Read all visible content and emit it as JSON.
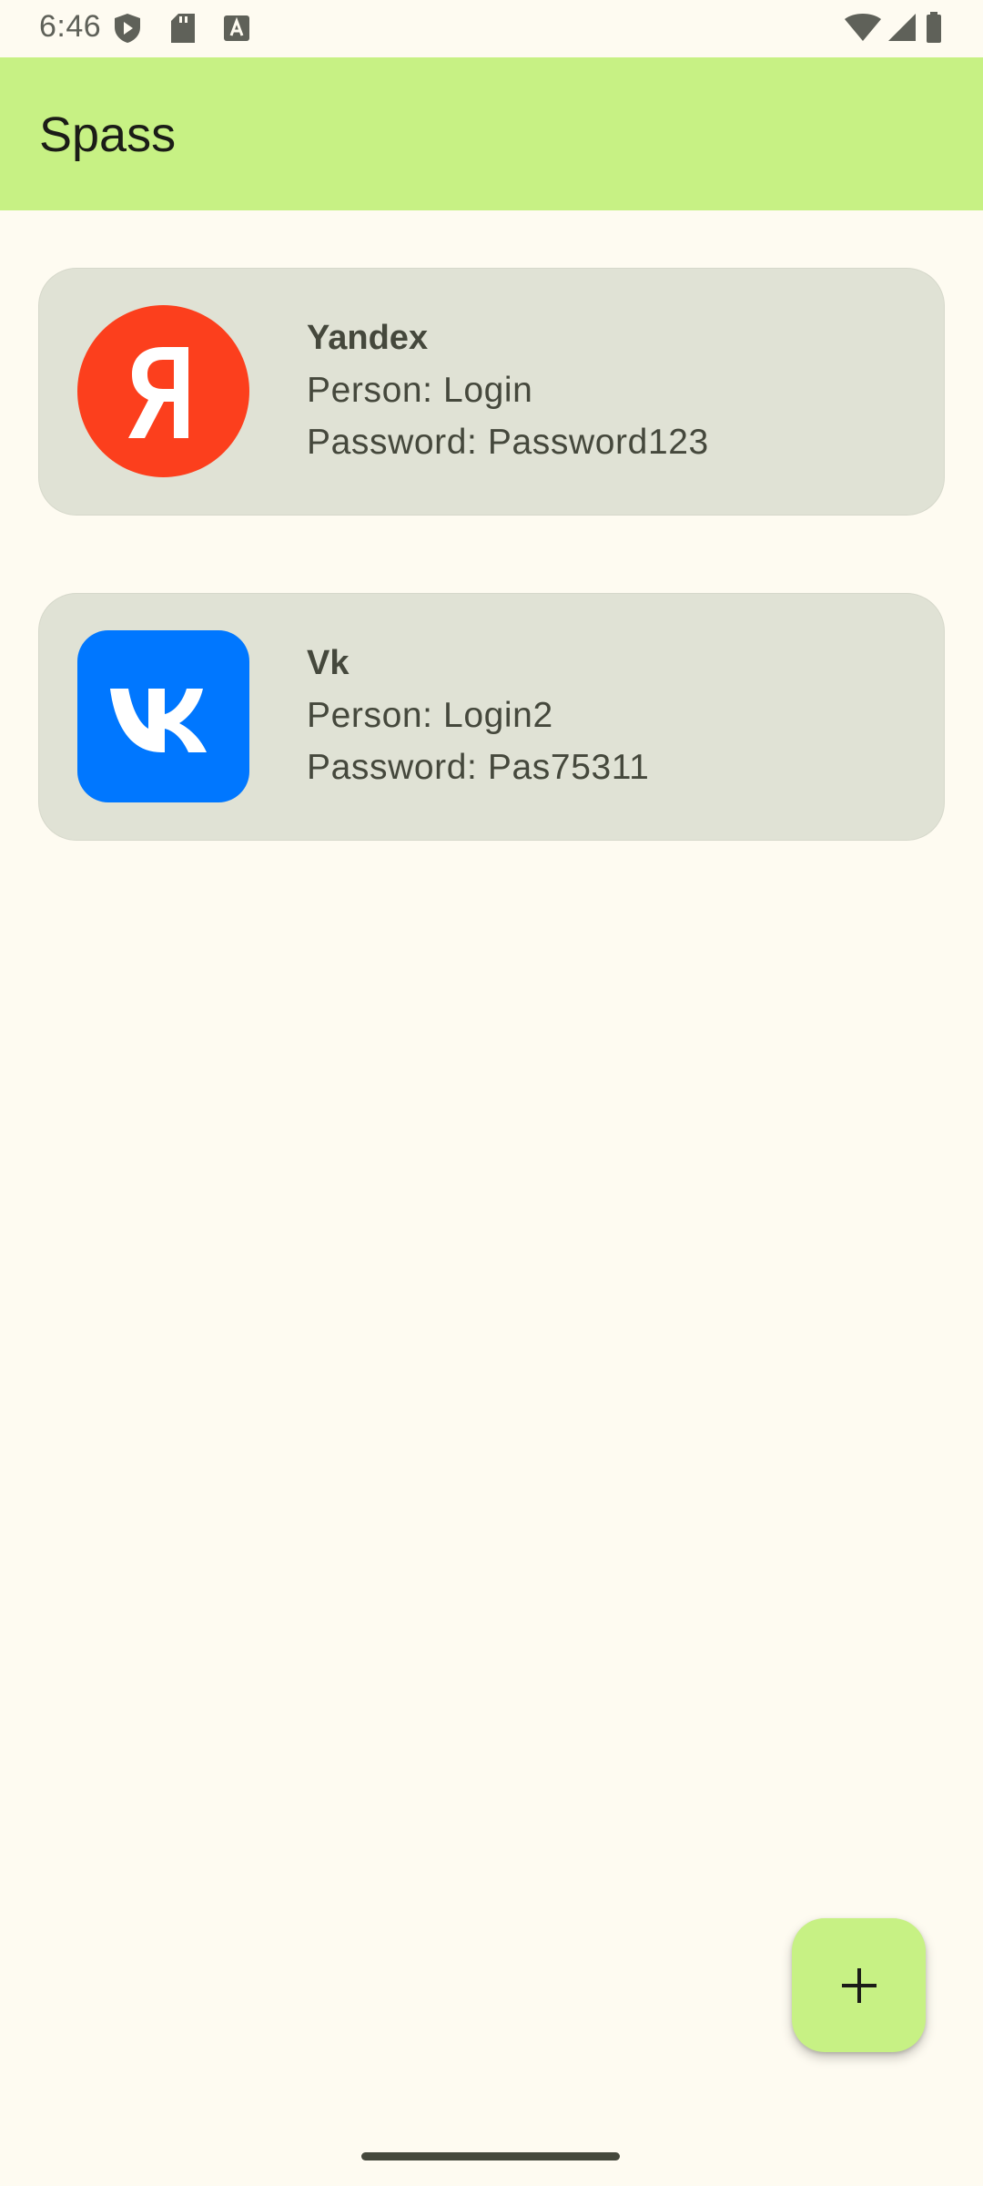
{
  "status_bar": {
    "time": "6:46",
    "left_icons": [
      "shield-play-icon",
      "sd-card-icon",
      "font-download-icon"
    ],
    "right_icons": [
      "wifi-icon",
      "signal-icon",
      "battery-icon"
    ]
  },
  "app_bar": {
    "title": "Spass"
  },
  "entries": [
    {
      "service": "Yandex",
      "person": "Person: Login",
      "password": "Password: Password123",
      "logo": "yandex-logo",
      "logo_color": "#fc3f1d"
    },
    {
      "service": "Vk",
      "person": "Person: Login2",
      "password": "Password: Pas75311",
      "logo": "vk-logo",
      "logo_color": "#0077ff"
    }
  ],
  "fab": {
    "icon": "plus-icon"
  },
  "colors": {
    "background": "#fefbf1",
    "app_bar": "#c7f184",
    "card": "#e0e2d5",
    "text": "#45483c"
  }
}
